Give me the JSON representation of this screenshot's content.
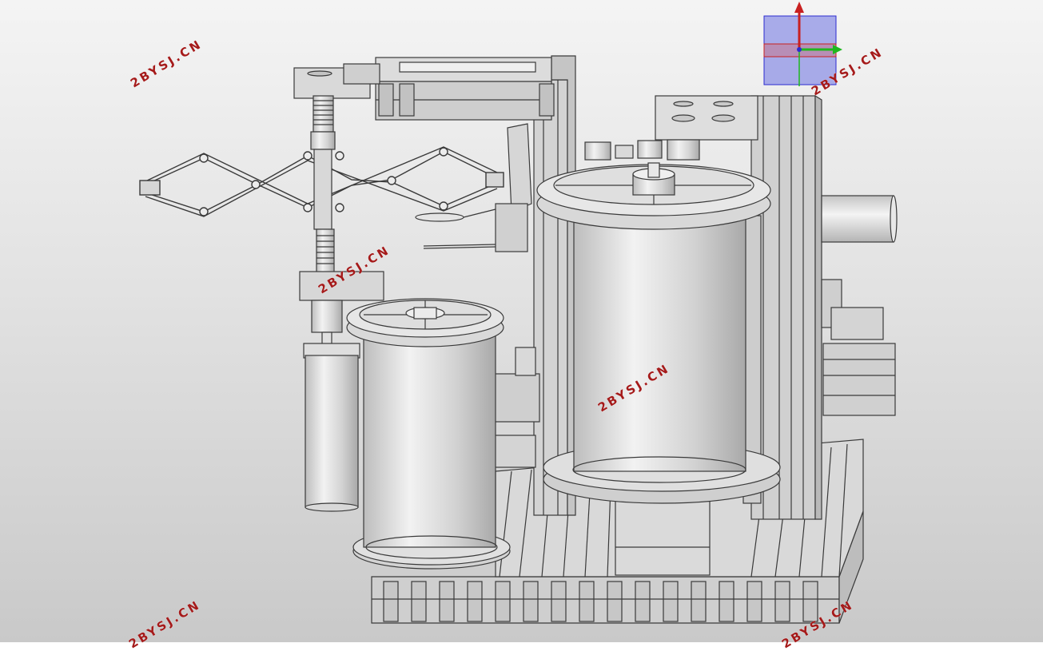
{
  "viewport": {
    "background_top": "#f4f4f4",
    "background_bottom": "#c9c9c9"
  },
  "watermarks": [
    {
      "id": "wm-1",
      "text": "2BYSJ.CN"
    },
    {
      "id": "wm-2",
      "text": "2BYSJ.CN"
    },
    {
      "id": "wm-3",
      "text": "2BYSJ.CN"
    },
    {
      "id": "wm-4",
      "text": "2BYSJ.CN"
    },
    {
      "id": "wm-5",
      "text": "2BYSJ.CN"
    },
    {
      "id": "wm-6",
      "text": "2BYSJ.CN"
    }
  ],
  "watermark_color": "#a51a1a",
  "triad": {
    "x_color": "#c82020",
    "y_color": "#1fb81f",
    "z_color": "#2b2bd0",
    "box_fill": "#8f93e6"
  },
  "model": {
    "part_fill": "#d6d6d6",
    "part_stroke": "#3a3a3a"
  }
}
